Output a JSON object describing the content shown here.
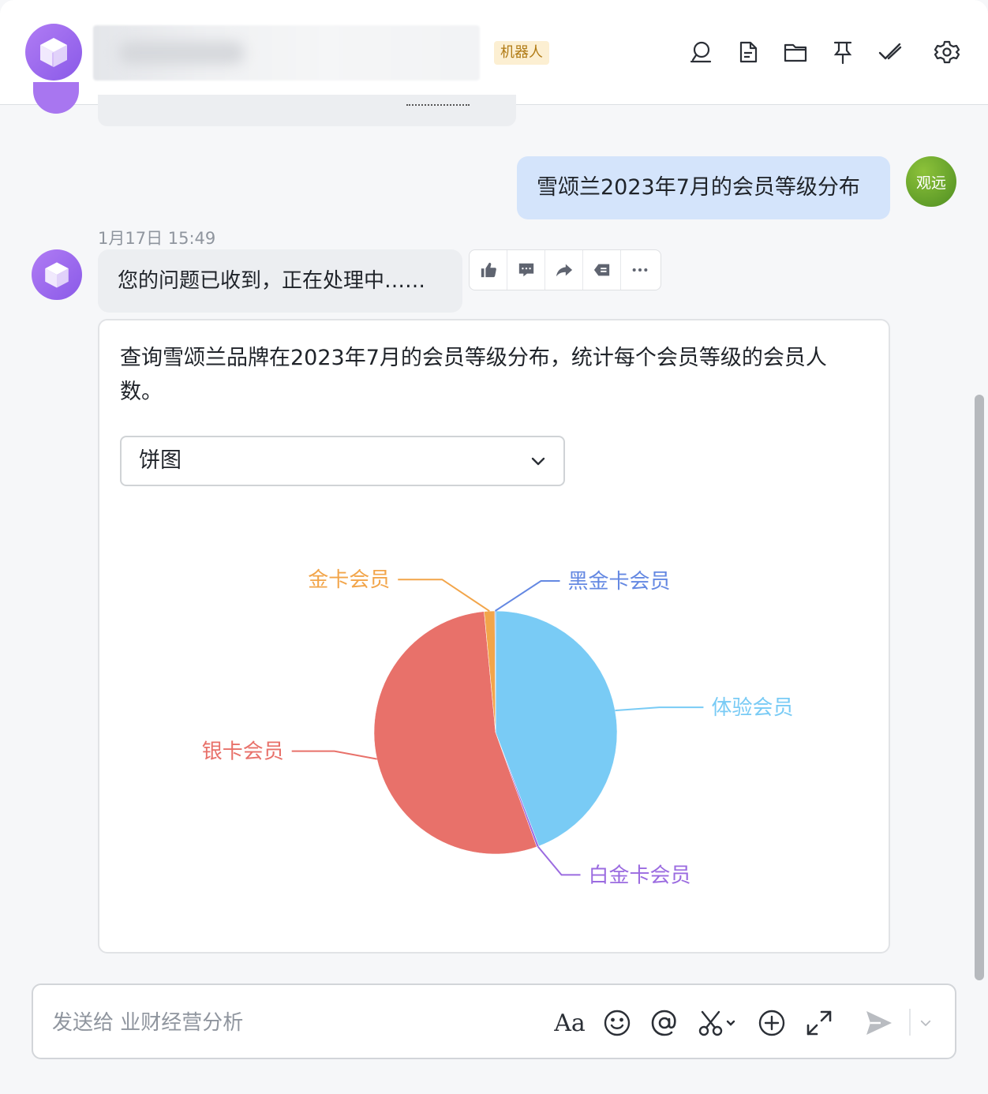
{
  "header": {
    "bot_tag": "机器人",
    "icons": [
      "search-chat-icon",
      "document-icon",
      "folder-icon",
      "pin-icon",
      "check-mark-icon",
      "settings-icon"
    ]
  },
  "messages": {
    "user_question": "雪颂兰2023年7月的会员等级分布",
    "user_avatar_text": "观远",
    "timestamp": "1月17日 15:49",
    "bot_reply": "您的问题已收到，正在处理中……",
    "card_text": "查询雪颂兰品牌在2023年7月的会员等级分布，统计每个会员等级的会员人数。",
    "chart_type_select": "饼图"
  },
  "message_actions": [
    "thumbs-up-icon",
    "comment-icon",
    "share-icon",
    "quote-icon",
    "more-icon"
  ],
  "composer": {
    "placeholder": "发送给 业财经营分析",
    "aa_label": "Aa"
  },
  "colors": {
    "accent_purple": "#9b6cf0",
    "user_bubble": "#d4e4fb",
    "bot_tag_bg": "#fcefd2"
  },
  "chart_data": {
    "type": "pie",
    "title": "",
    "series": [
      {
        "name": "体验会员",
        "value": 44.2,
        "color": "#79cbf5"
      },
      {
        "name": "白金卡会员",
        "value": 0.3,
        "color": "#9b6be0"
      },
      {
        "name": "银卡会员",
        "value": 54.0,
        "color": "#e8716a"
      },
      {
        "name": "金卡会员",
        "value": 1.4,
        "color": "#f2a54a"
      },
      {
        "name": "黑金卡会员",
        "value": 0.1,
        "color": "#6488e2"
      }
    ],
    "legend": "none",
    "labels": "outside-with-leader-lines"
  }
}
